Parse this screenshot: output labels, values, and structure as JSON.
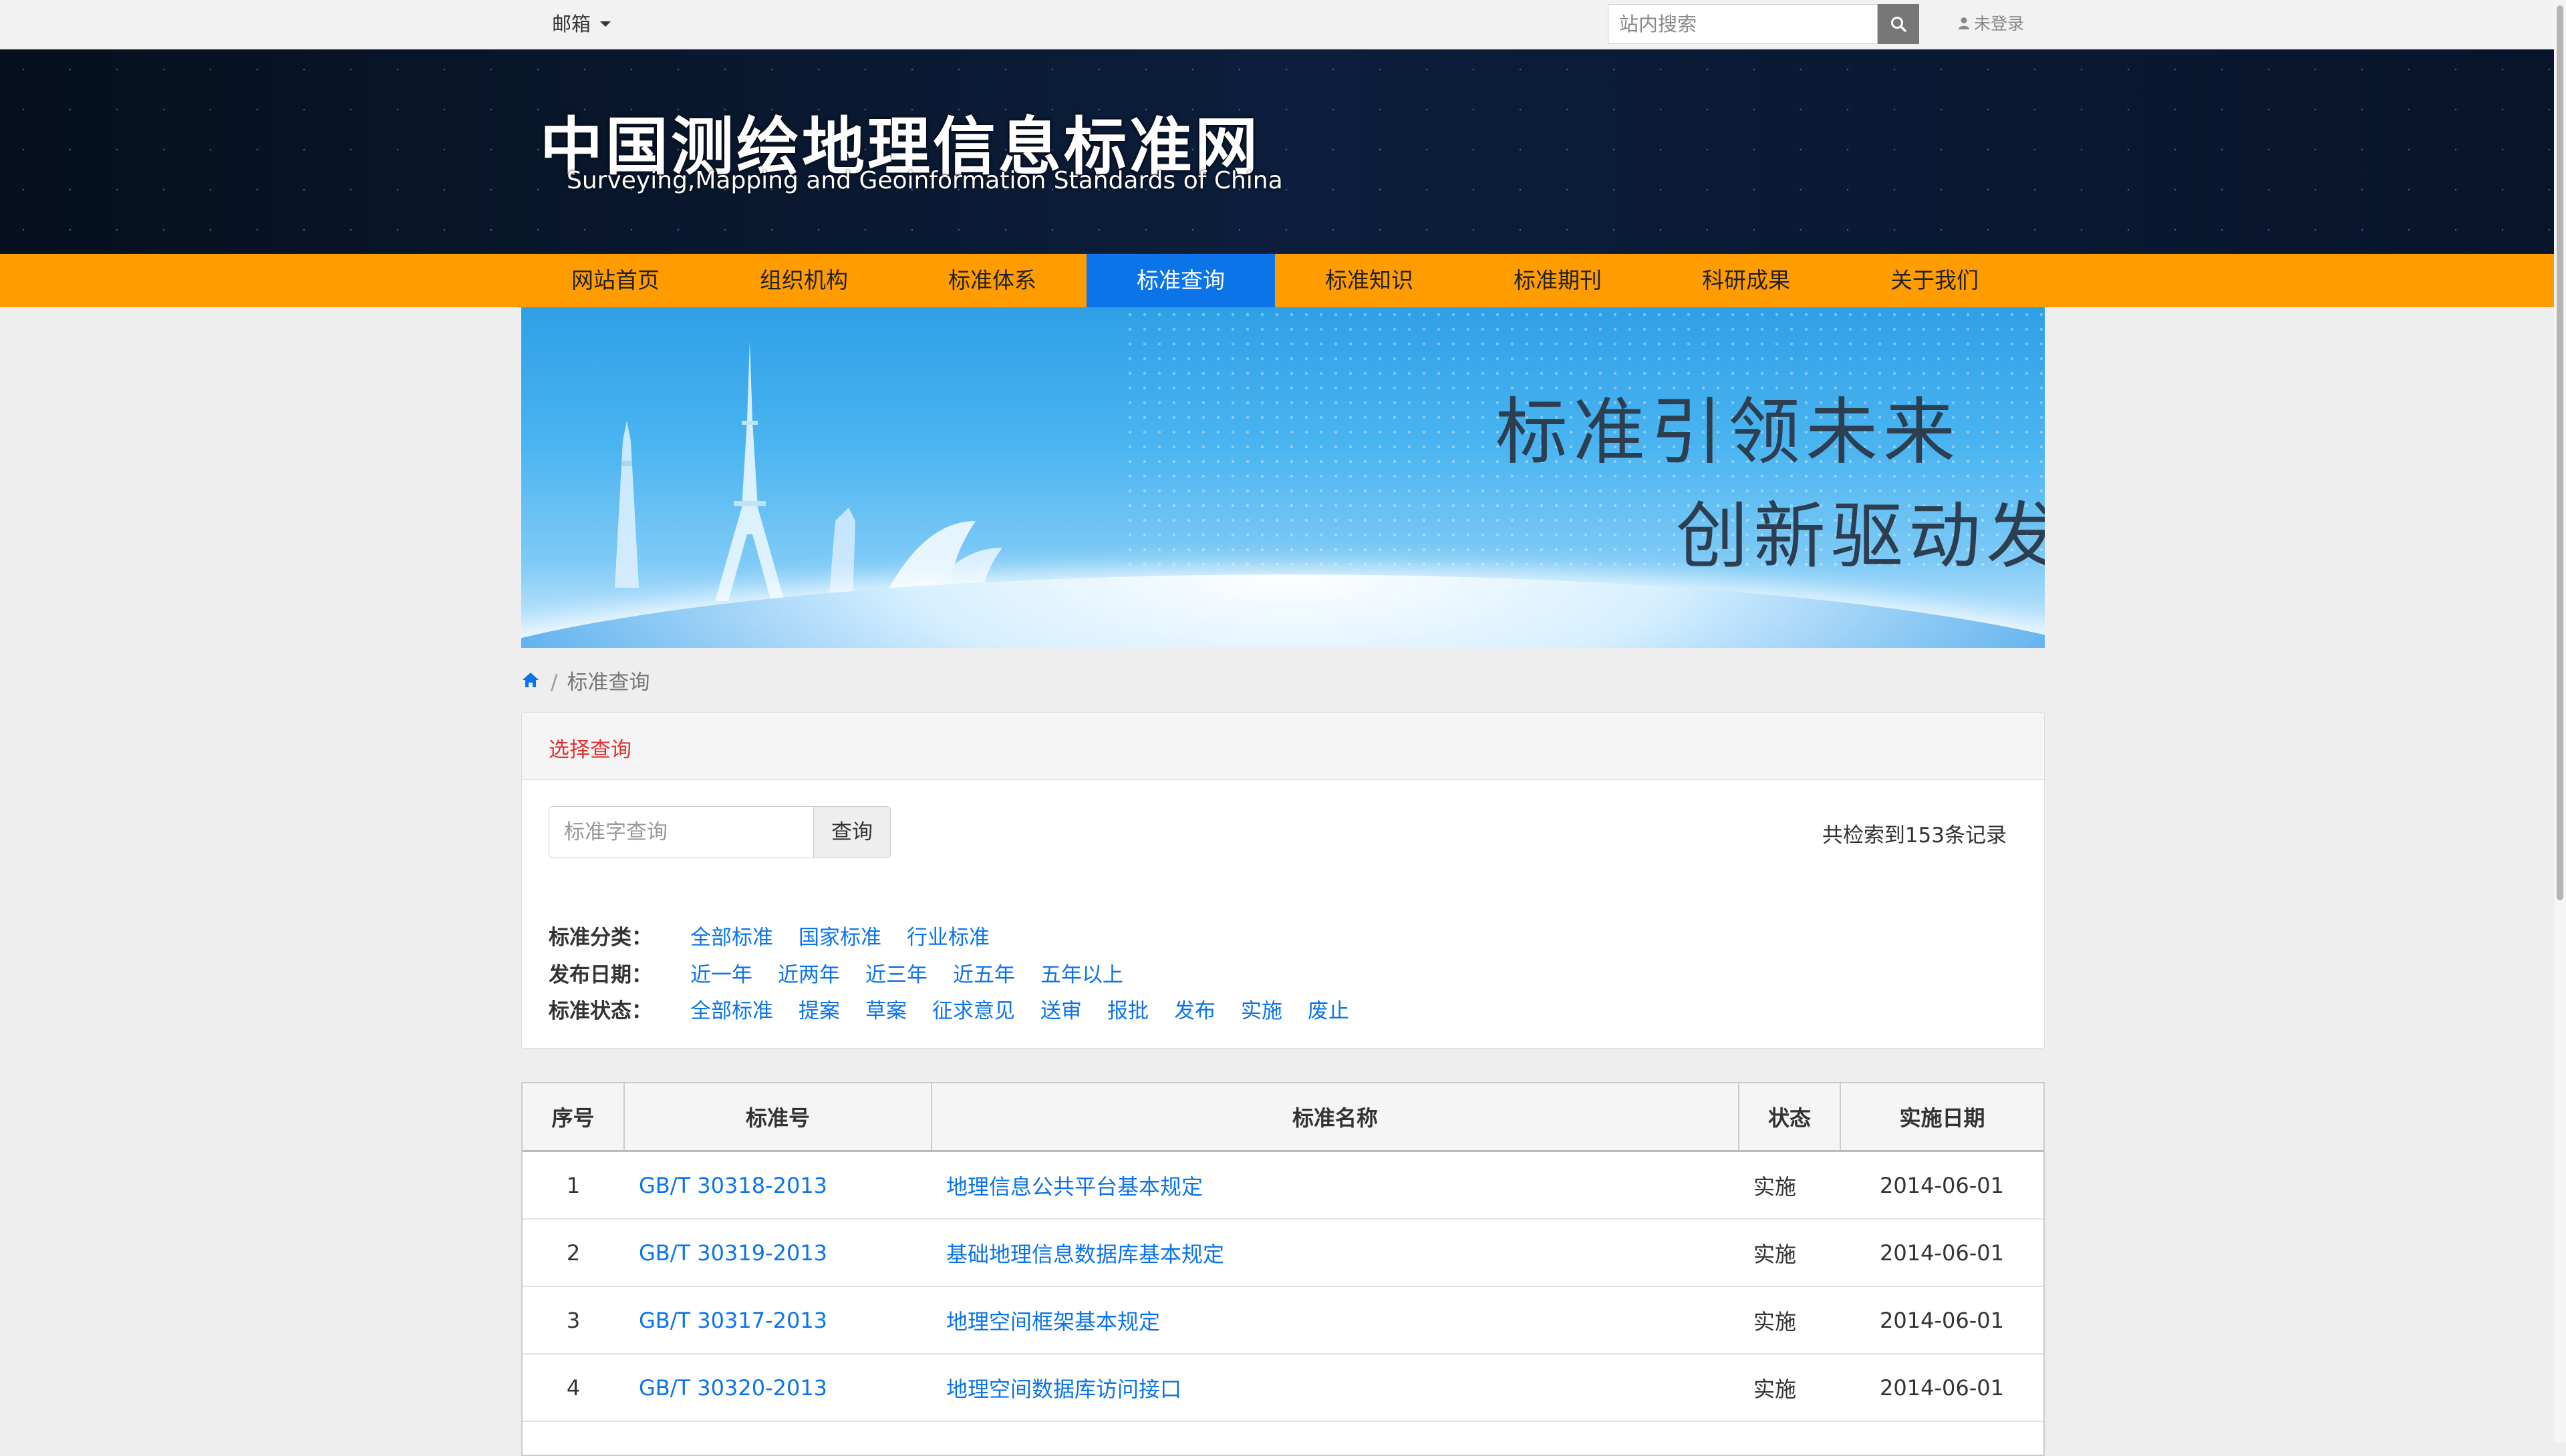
{
  "topbar": {
    "mail_label": "邮箱",
    "search_placeholder": "站内搜索",
    "login_status": "未登录"
  },
  "header": {
    "title": "中国测绘地理信息标准网",
    "subtitle": "Surveying,Mapping and Geoinformation Standards of China"
  },
  "nav": {
    "items": [
      "网站首页",
      "组织机构",
      "标准体系",
      "标准查询",
      "标准知识",
      "标准期刊",
      "科研成果",
      "关于我们"
    ],
    "active_index": 3,
    "bar_color": "#ff9c00",
    "active_color": "#0b74e8"
  },
  "banner": {
    "line1": "标准引领未来",
    "line2": "创新驱动发展"
  },
  "breadcrumb": {
    "current": "标准查询"
  },
  "query": {
    "panel_title": "选择查询",
    "input_placeholder": "标准字查询",
    "button_label": "查询",
    "record_count": "共检索到153条记录",
    "filters": [
      {
        "label": "标准分类：",
        "options": [
          "全部标准",
          "国家标准",
          "行业标准"
        ]
      },
      {
        "label": "发布日期：",
        "options": [
          "近一年",
          "近两年",
          "近三年",
          "近五年",
          "五年以上"
        ]
      },
      {
        "label": "标准状态：",
        "options": [
          "全部标准",
          "提案",
          "草案",
          "征求意见",
          "送审",
          "报批",
          "发布",
          "实施",
          "废止"
        ]
      }
    ]
  },
  "table": {
    "headers": [
      "序号",
      "标准号",
      "标准名称",
      "状态",
      "实施日期"
    ],
    "rows": [
      {
        "no": "1",
        "code": "GB/T 30318-2013",
        "name": "地理信息公共平台基本规定",
        "status": "实施",
        "date": "2014-06-01"
      },
      {
        "no": "2",
        "code": "GB/T 30319-2013",
        "name": "基础地理信息数据库基本规定",
        "status": "实施",
        "date": "2014-06-01"
      },
      {
        "no": "3",
        "code": "GB/T 30317-2013",
        "name": "地理空间框架基本规定",
        "status": "实施",
        "date": "2014-06-01"
      },
      {
        "no": "4",
        "code": "GB/T 30320-2013",
        "name": "地理空间数据库访问接口",
        "status": "实施",
        "date": "2014-06-01"
      }
    ]
  }
}
